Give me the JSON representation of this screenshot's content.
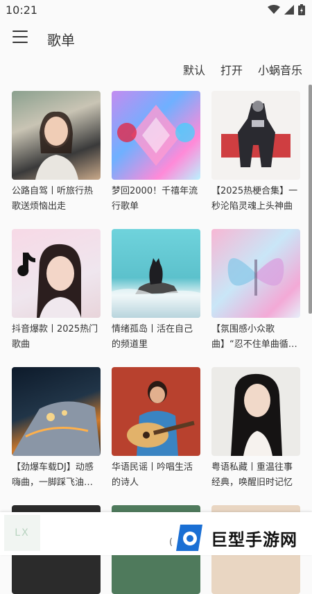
{
  "status": {
    "time": "10:21"
  },
  "header": {
    "title": "歌单"
  },
  "sort": {
    "default": "默认",
    "open": "打开",
    "source": "小蜗音乐"
  },
  "playlists": [
    {
      "title": "公路自驾丨听旅行热歌送烦恼出走"
    },
    {
      "title": "梦回2000！千禧年流行歌单"
    },
    {
      "title": "【2025热梗合集】一秒沦陷灵魂上头神曲"
    },
    {
      "title": "抖音爆款丨2025热门歌曲"
    },
    {
      "title": "情绪孤岛丨活在自己的频道里"
    },
    {
      "title": "【氛围感小众歌曲】“忍不住单曲循…"
    },
    {
      "title": "【劲爆车载DJ】动感嗨曲，一脚踩飞油…"
    },
    {
      "title": "华语民谣丨吟唱生活的诗人"
    },
    {
      "title": "粤语私藏丨重温往事经典，唤醒旧时记忆"
    }
  ],
  "player": {
    "cover_text": "LX",
    "title": "("
  },
  "watermark": {
    "text": "巨型手游网"
  },
  "colors": {
    "accent": "#1a6fd4"
  }
}
